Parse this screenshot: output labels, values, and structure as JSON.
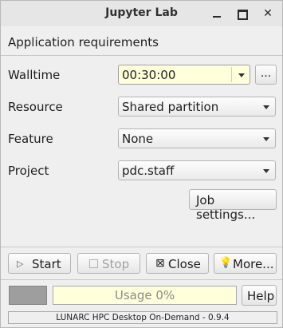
{
  "window": {
    "title": "Jupyter Lab",
    "controls": [
      "minimize-icon",
      "maximize-icon",
      "close-icon"
    ]
  },
  "section": {
    "title": "Application requirements"
  },
  "form": {
    "walltime": {
      "label": "Walltime",
      "value": "00:30:00",
      "browse_label": "..."
    },
    "resource": {
      "label": "Resource",
      "value": "Shared partition"
    },
    "feature": {
      "label": "Feature",
      "value": "None"
    },
    "project": {
      "label": "Project",
      "value": "pdc.staff"
    },
    "job_settings_label": "Job settings..."
  },
  "actions": {
    "start": {
      "label": "Start",
      "icon": "play-icon",
      "enabled": true
    },
    "stop": {
      "label": "Stop",
      "icon": "stop-icon",
      "enabled": false
    },
    "close": {
      "label": "Close",
      "icon": "x-icon",
      "enabled": true
    },
    "more": {
      "label": "More...",
      "icon": "lightbulb-icon",
      "enabled": true
    }
  },
  "status": {
    "usage_text": "Usage 0%",
    "usage_fraction": 0,
    "help_label": "Help",
    "indicator_color": "#9e9e9e"
  },
  "footer": {
    "text": "LUNARC HPC Desktop On-Demand - 0.9.4"
  }
}
